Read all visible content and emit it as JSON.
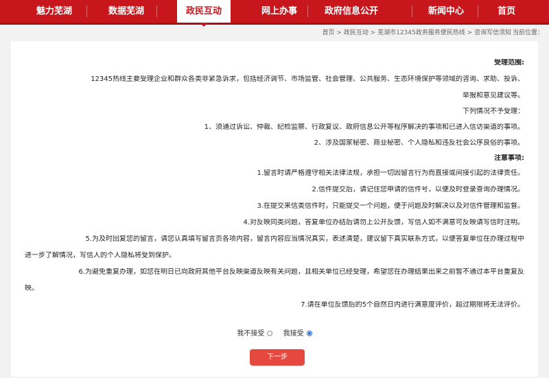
{
  "nav": {
    "items": [
      {
        "label": "首页"
      },
      {
        "label": "新闻中心"
      },
      {
        "label": "政府信息公开"
      },
      {
        "label": "网上办事"
      },
      {
        "label": "政民互动"
      },
      {
        "label": "数据芜湖"
      },
      {
        "label": "魅力芜湖"
      }
    ],
    "active_label": "政民互动"
  },
  "breadcrumb": {
    "prefix": "当前位置：",
    "path": "首页 > 政民互动 > 芜湖市12345政务服务便民热线 > 咨询写信须知"
  },
  "content": {
    "scope_heading": "受理范围:",
    "scope_line1": "12345热线主要受理企业和群众各类非紧急诉求，包括经济调节、市场监管、社会管理、公共服务、生态环境保护等领域的咨询、求助、投诉、",
    "scope_line2": "举报和意见建议等。",
    "not_accepted_intro": "下列情况不予受理：",
    "not_accepted_1": "1、须通过诉讼、仲裁、纪检监察、行政复议、政府信息公开等程序解决的事项和已进入信访渠道的事项。",
    "not_accepted_2": "2、涉及国家秘密、商业秘密、个人隐私和违反社会公序良俗的事项。",
    "notes_heading": "注意事项:",
    "notes": [
      "1.留言时请严格遵守相关法律法规，承担一切因留言行为而直接或间接引起的法律责任。",
      "2.信件提交后，请记住您申请的信件号，以便及时登录查询办理情况。",
      "3.在提交来信类信件时，只能提交一个问题，便于问题及时解决以及对信件管理和监督。",
      "4.对反映同类问题，答复单位办结后请勿上公开反馈，写信人如不满意可反映请写信时注明。",
      "5.为及时回复您的留言，请您认真填写留言页各项内容，留言内容应当情况真实，表述清楚，建议留下真实联系方式，以便答复单位在办理过程中"
    ],
    "note5_cont": "进一步了解情况，写信人的个人隐私将受到保护。",
    "note6": "6.为避免重复办理，如您在明日已向政府其他平台反映渠道反映有关问题，且相关单位已经受理，希望您在办理结果出来之前暂不通过本平台重复反",
    "note6_cont": "映。",
    "note7": "7.请在单位反馈后的5个自然日内进行满意度评价，超过期限将无法评价。"
  },
  "form": {
    "accept_label": "我接受",
    "reject_label": "我不接受",
    "selected": "accept",
    "next_label": "下一步"
  }
}
